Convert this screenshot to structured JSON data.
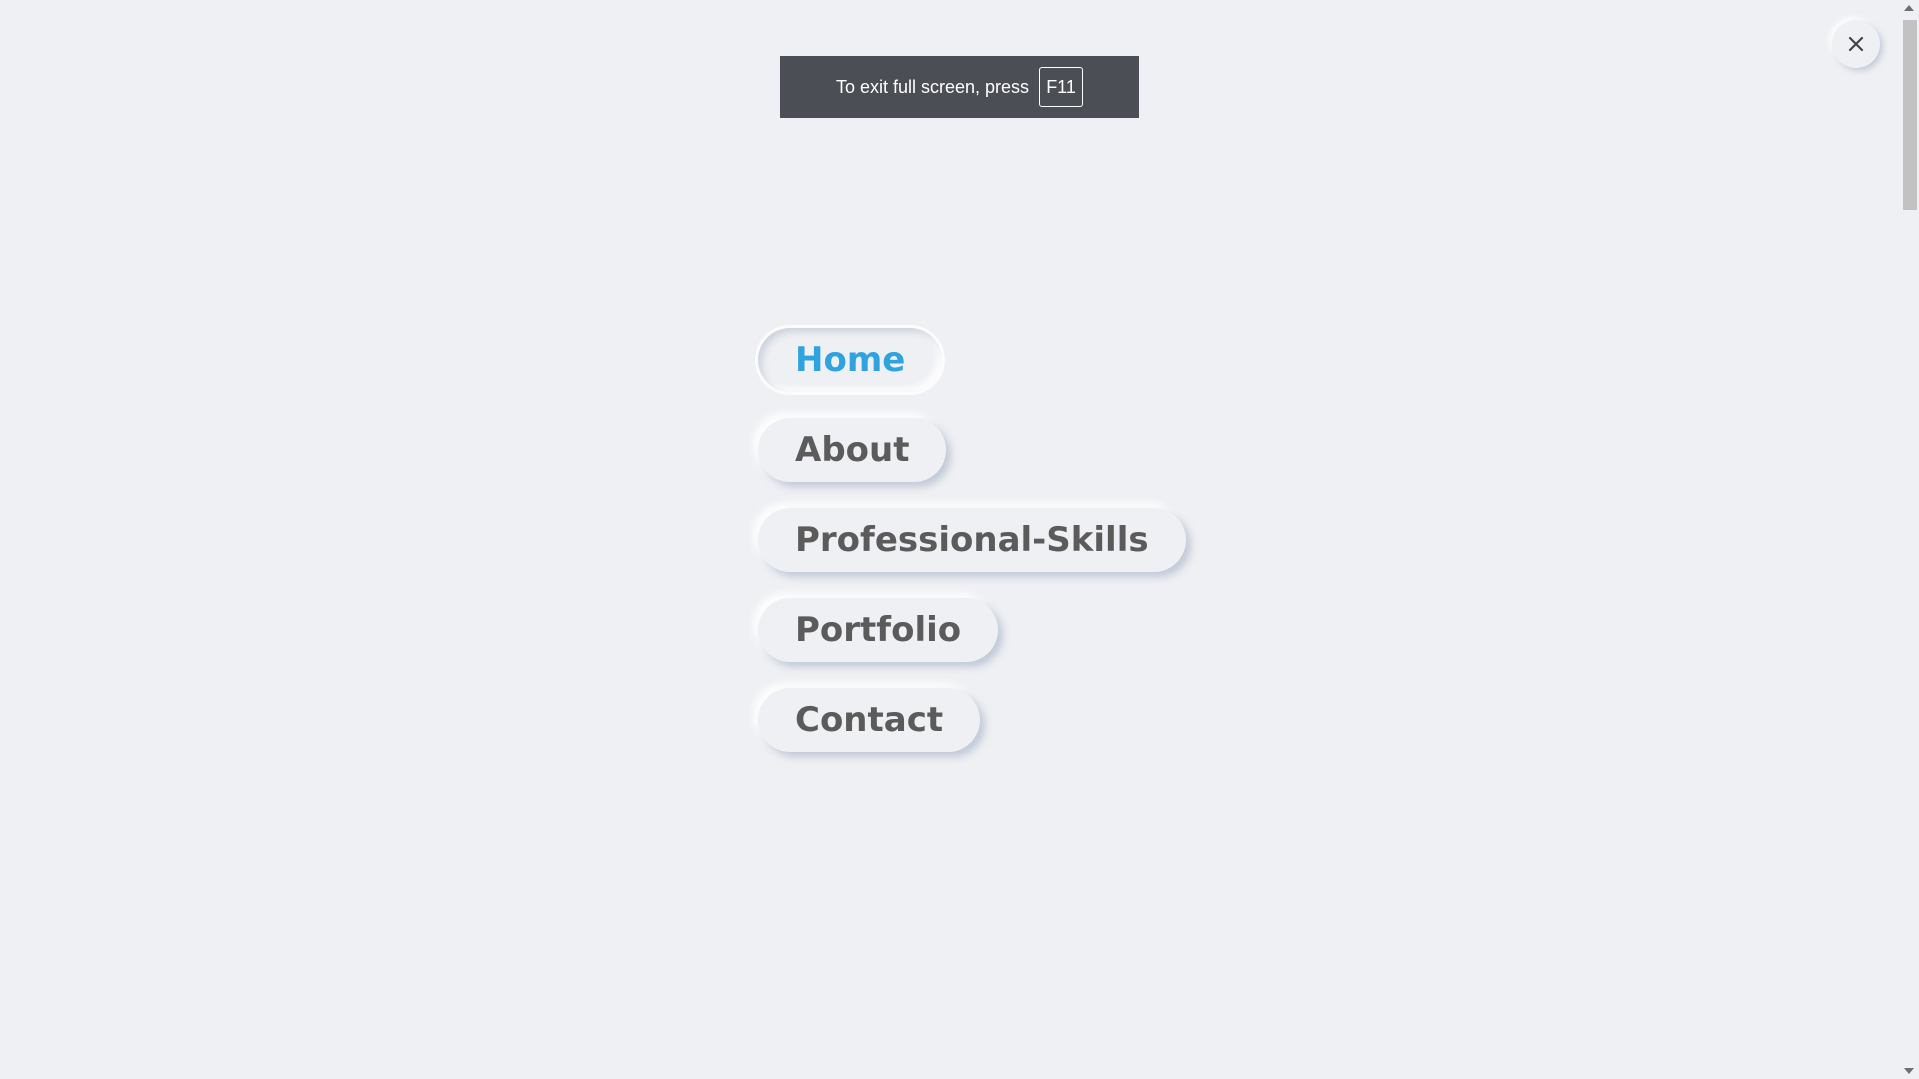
{
  "fullscreen_notice": {
    "text": "To exit full screen, press",
    "key": "F11"
  },
  "close_button": {
    "icon": "close-icon"
  },
  "menu": {
    "items": [
      {
        "label": "Home",
        "active": true
      },
      {
        "label": "About",
        "active": false
      },
      {
        "label": "Professional-Skills",
        "active": false
      },
      {
        "label": "Portfolio",
        "active": false
      },
      {
        "label": "Contact",
        "active": false
      }
    ]
  },
  "colors": {
    "background": "#eff0f3",
    "active_text": "#2ea3df",
    "text": "#5b5b5b",
    "toast_background": "#4b4e55"
  }
}
